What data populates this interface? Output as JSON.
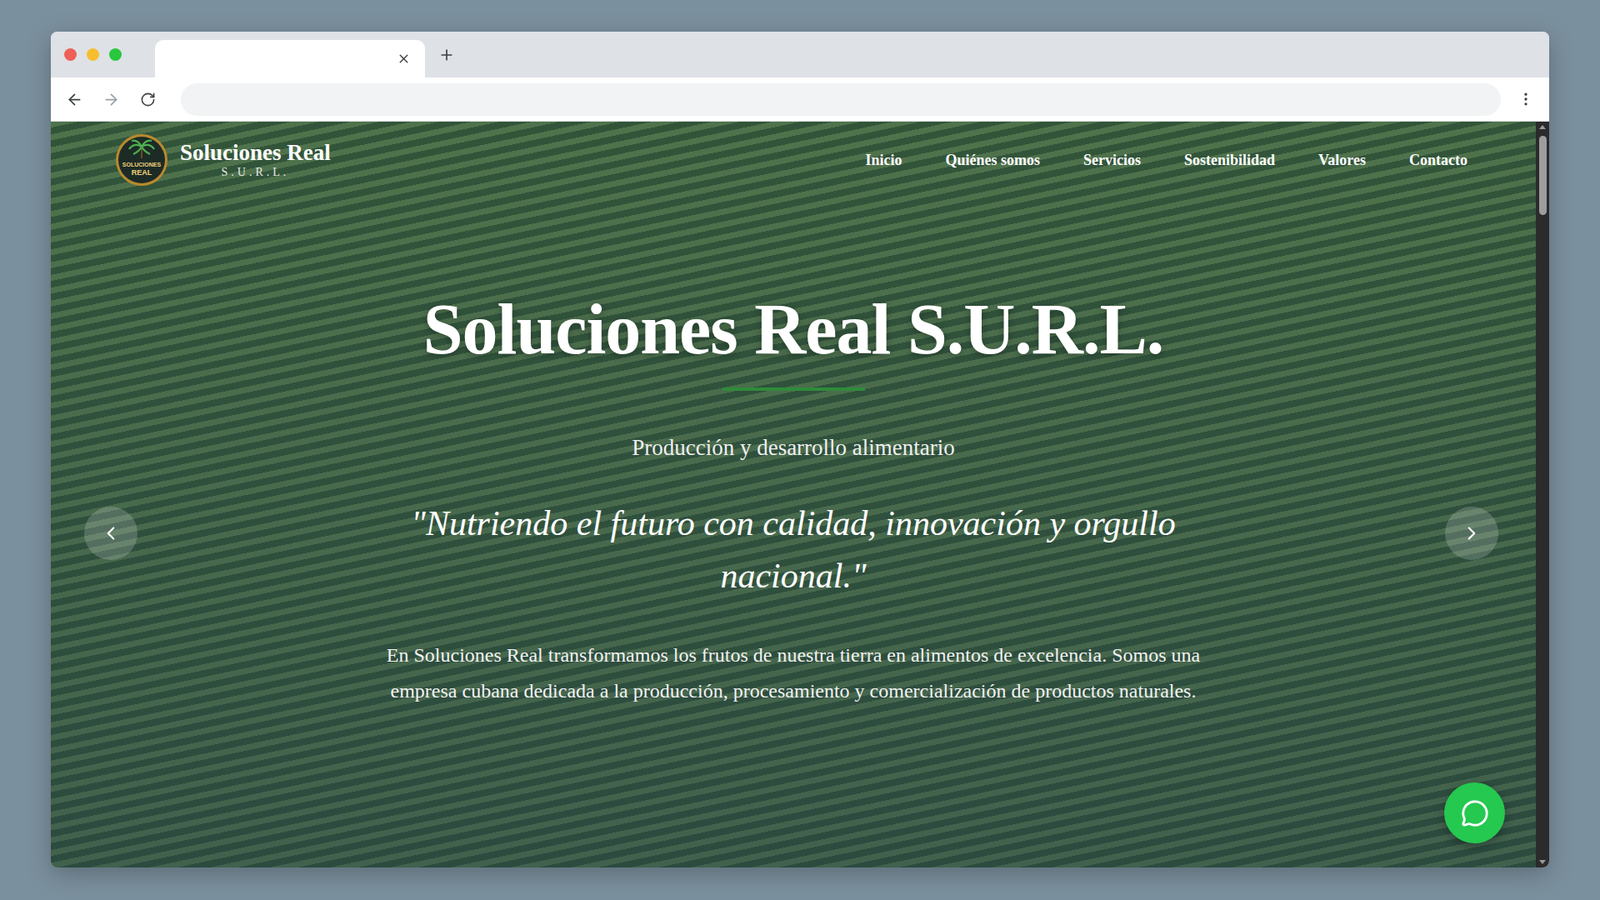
{
  "browser": {
    "tabs": [
      {
        "selected": true
      }
    ]
  },
  "site": {
    "brand": {
      "name": "Soluciones Real",
      "suffix": "S.U.R.L.",
      "logo_text": [
        "SOLUCIONES",
        "REAL"
      ]
    },
    "nav": [
      {
        "label": "Inicio"
      },
      {
        "label": "Quiénes somos"
      },
      {
        "label": "Servicios"
      },
      {
        "label": "Sostenibilidad"
      },
      {
        "label": "Valores"
      },
      {
        "label": "Contacto"
      }
    ],
    "hero": {
      "title": "Soluciones Real S.U.R.L.",
      "subtitle": "Producción y desarrollo alimentario",
      "quote": "\"Nutriendo el futuro con calidad, innovación y orgullo nacional.\"",
      "body": "En Soluciones Real transformamos los frutos de nuestra tierra en alimentos de excelencia. Somos una empresa cubana dedicada a la producción, procesamiento y comercialización de productos naturales."
    },
    "scrollbar": {
      "level": 0.11
    }
  }
}
